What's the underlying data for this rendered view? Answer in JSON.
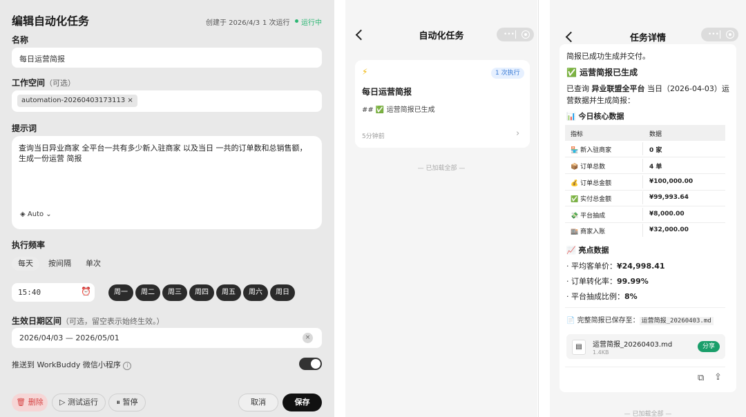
{
  "left": {
    "title": "编辑自动化任务",
    "created": "创建于 2026/4/3",
    "runs": "1 次运行",
    "status": "运行中",
    "status_color": "#2bb673",
    "name_label": "名称",
    "name_value": "每日运营简报",
    "workspace_label": "工作空间",
    "workspace_optional": "（可选）",
    "workspace_tag": "automation-20260403173113 ×",
    "prompt_label": "提示词",
    "prompt_text": "查询当日异业商家 全平台一共有多少新入驻商家 以及当日 一共的订单数和总销售额，生成一份运营 简报",
    "model": "Auto",
    "frequency_label": "执行频率",
    "frequency_options": [
      "每天",
      "按间隔",
      "单次"
    ],
    "time_value": "15:40",
    "weekdays": [
      "周一",
      "周二",
      "周三",
      "周四",
      "周五",
      "周六",
      "周日"
    ],
    "date_label": "生效日期区间",
    "date_hint": "（可选，留空表示始终生效。）",
    "date_value": "2026/04/03 — 2026/05/01",
    "push_label": "推送到 WorkBuddy 微信小程序",
    "push_enabled": true,
    "delete_label": "删除",
    "test_label": "测试运行",
    "pause_label": "暂停",
    "cancel_label": "取消",
    "save_label": "保存"
  },
  "mid": {
    "title": "自动化任务",
    "card_badge": "1 次执行",
    "card_title": "每日运营简报",
    "card_summary": "## ✅ 运营简报已生成",
    "card_time": "5分钟前",
    "loaded_all": "— 已加载全部 —"
  },
  "right": {
    "title": "任务详情",
    "line_top": "简报已成功生成并交付。",
    "heading1": "✅ 运营简报已生成",
    "para_prefix": "已查询",
    "para_bold": "异业联盟全平台",
    "para_suffix": "当日（2026-04-03）运",
    "para_line2": "营数据并生成简报：",
    "heading2": "📊 今日核心数据",
    "table_head": [
      "指标",
      "数据"
    ],
    "table_rows": [
      {
        "icon": "🏪",
        "metric": "新入驻商家",
        "value": "0 家"
      },
      {
        "icon": "📦",
        "metric": "订单总数",
        "value": "4 单"
      },
      {
        "icon": "💰",
        "metric": "订单总金额",
        "value": "¥100,000.00"
      },
      {
        "icon": "✅",
        "metric": "实付总金额",
        "value": "¥99,993.64"
      },
      {
        "icon": "💸",
        "metric": "平台抽成",
        "value": "¥8,000.00"
      },
      {
        "icon": "🏬",
        "metric": "商家入账",
        "value": "¥32,000.00"
      }
    ],
    "heading3": "📈 亮点数据",
    "highlights": [
      {
        "label": "平均客单价：",
        "value": "¥24,998.41"
      },
      {
        "label": "订单转化率：",
        "value": "99.99%"
      },
      {
        "label": "平台抽成比例：",
        "value": "8%"
      }
    ],
    "saved_label": "完整简报已保存至：",
    "saved_file": "运营简报_20260403.md",
    "file_name": "运营简报_20260403.md",
    "file_size": "1.4KB",
    "share_label": "分享",
    "share_color": "#1a9e6a",
    "loaded_all": "— 已加载全部 —"
  }
}
